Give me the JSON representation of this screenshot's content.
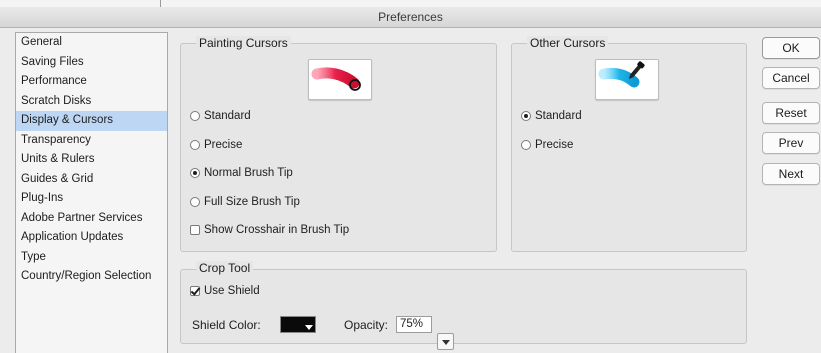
{
  "window": {
    "title": "Preferences"
  },
  "sidebar": {
    "items": [
      {
        "label": "General"
      },
      {
        "label": "Saving Files"
      },
      {
        "label": "Performance"
      },
      {
        "label": "Scratch Disks"
      },
      {
        "label": "Display & Cursors",
        "selected": true
      },
      {
        "label": "Transparency"
      },
      {
        "label": "Units & Rulers"
      },
      {
        "label": "Guides & Grid"
      },
      {
        "label": "Plug-Ins"
      },
      {
        "label": "Adobe Partner Services"
      },
      {
        "label": "Application Updates"
      },
      {
        "label": "Type"
      },
      {
        "label": "Country/Region Selection"
      }
    ]
  },
  "painting_cursors": {
    "title": "Painting Cursors",
    "preview_color": "#e8204a",
    "options": [
      {
        "label": "Standard",
        "checked": false
      },
      {
        "label": "Precise",
        "checked": false
      },
      {
        "label": "Normal Brush Tip",
        "checked": true
      },
      {
        "label": "Full Size Brush Tip",
        "checked": false
      }
    ],
    "crosshair": {
      "label": "Show Crosshair in Brush Tip",
      "checked": false
    }
  },
  "other_cursors": {
    "title": "Other Cursors",
    "preview_color": "#1fb6e8",
    "options": [
      {
        "label": "Standard",
        "checked": true
      },
      {
        "label": "Precise",
        "checked": false
      }
    ]
  },
  "crop_tool": {
    "title": "Crop Tool",
    "use_shield": {
      "label": "Use Shield",
      "checked": true
    },
    "shield_color_label": "Shield Color:",
    "shield_color": "#000000",
    "opacity_label": "Opacity:",
    "opacity_value": "75%"
  },
  "buttons": {
    "ok": "OK",
    "cancel": "Cancel",
    "reset": "Reset",
    "prev": "Prev",
    "next": "Next"
  }
}
